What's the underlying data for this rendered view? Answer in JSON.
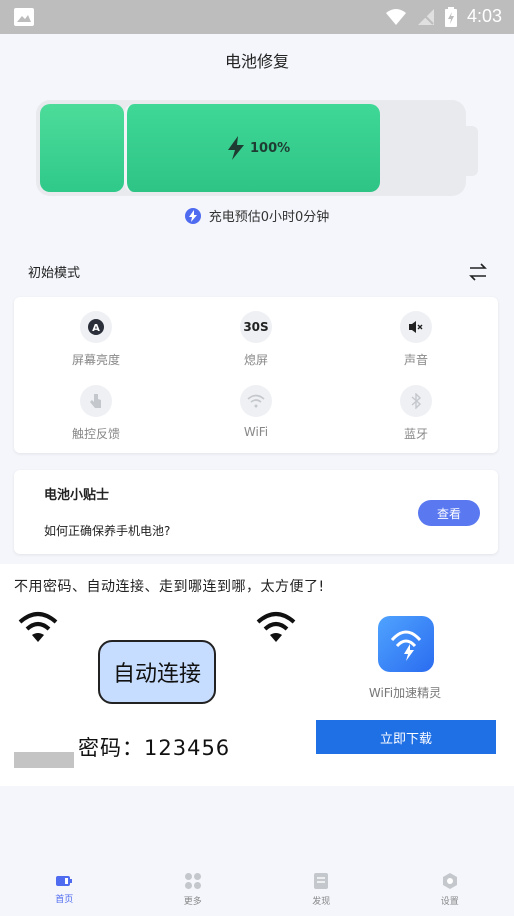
{
  "status_bar": {
    "time": "4:03"
  },
  "header": {
    "title": "电池修复"
  },
  "battery": {
    "percent": "100%",
    "level": 1.0,
    "charge_estimate": "充电预估0小时0分钟"
  },
  "mode": {
    "label": "初始模式"
  },
  "mode_items": [
    {
      "icon": "brightness-icon",
      "glyph": "A",
      "label": "屏幕亮度"
    },
    {
      "icon": "screen-off-timer-icon",
      "glyph": "30S",
      "label": "熄屏"
    },
    {
      "icon": "sound-mute-icon",
      "glyph": "",
      "label": "声音"
    },
    {
      "icon": "touch-feedback-icon",
      "glyph": "",
      "label": "触控反馈"
    },
    {
      "icon": "wifi-icon",
      "glyph": "",
      "label": "WiFi"
    },
    {
      "icon": "bluetooth-icon",
      "glyph": "",
      "label": "蓝牙"
    }
  ],
  "tips": {
    "title": "电池小贴士",
    "question": "如何正确保养手机电池?",
    "button": "查看"
  },
  "ad": {
    "headline": "不用密码、自动连接、走到哪连到哪，太方便了!",
    "bubble_text": "自动连接",
    "password_text": "密码：123456",
    "app_name": "WiFi加速精灵",
    "download_button": "立即下载"
  },
  "tabs": [
    {
      "label": "首页",
      "icon": "battery-tab-icon",
      "active": true
    },
    {
      "label": "更多",
      "icon": "grid-tab-icon",
      "active": false
    },
    {
      "label": "发现",
      "icon": "document-tab-icon",
      "active": false
    },
    {
      "label": "设置",
      "icon": "settings-tab-icon",
      "active": false
    }
  ],
  "colors": {
    "accent": "#4f6bf0",
    "battery_green": "#2fc98a",
    "download_blue": "#1f6fe5"
  }
}
